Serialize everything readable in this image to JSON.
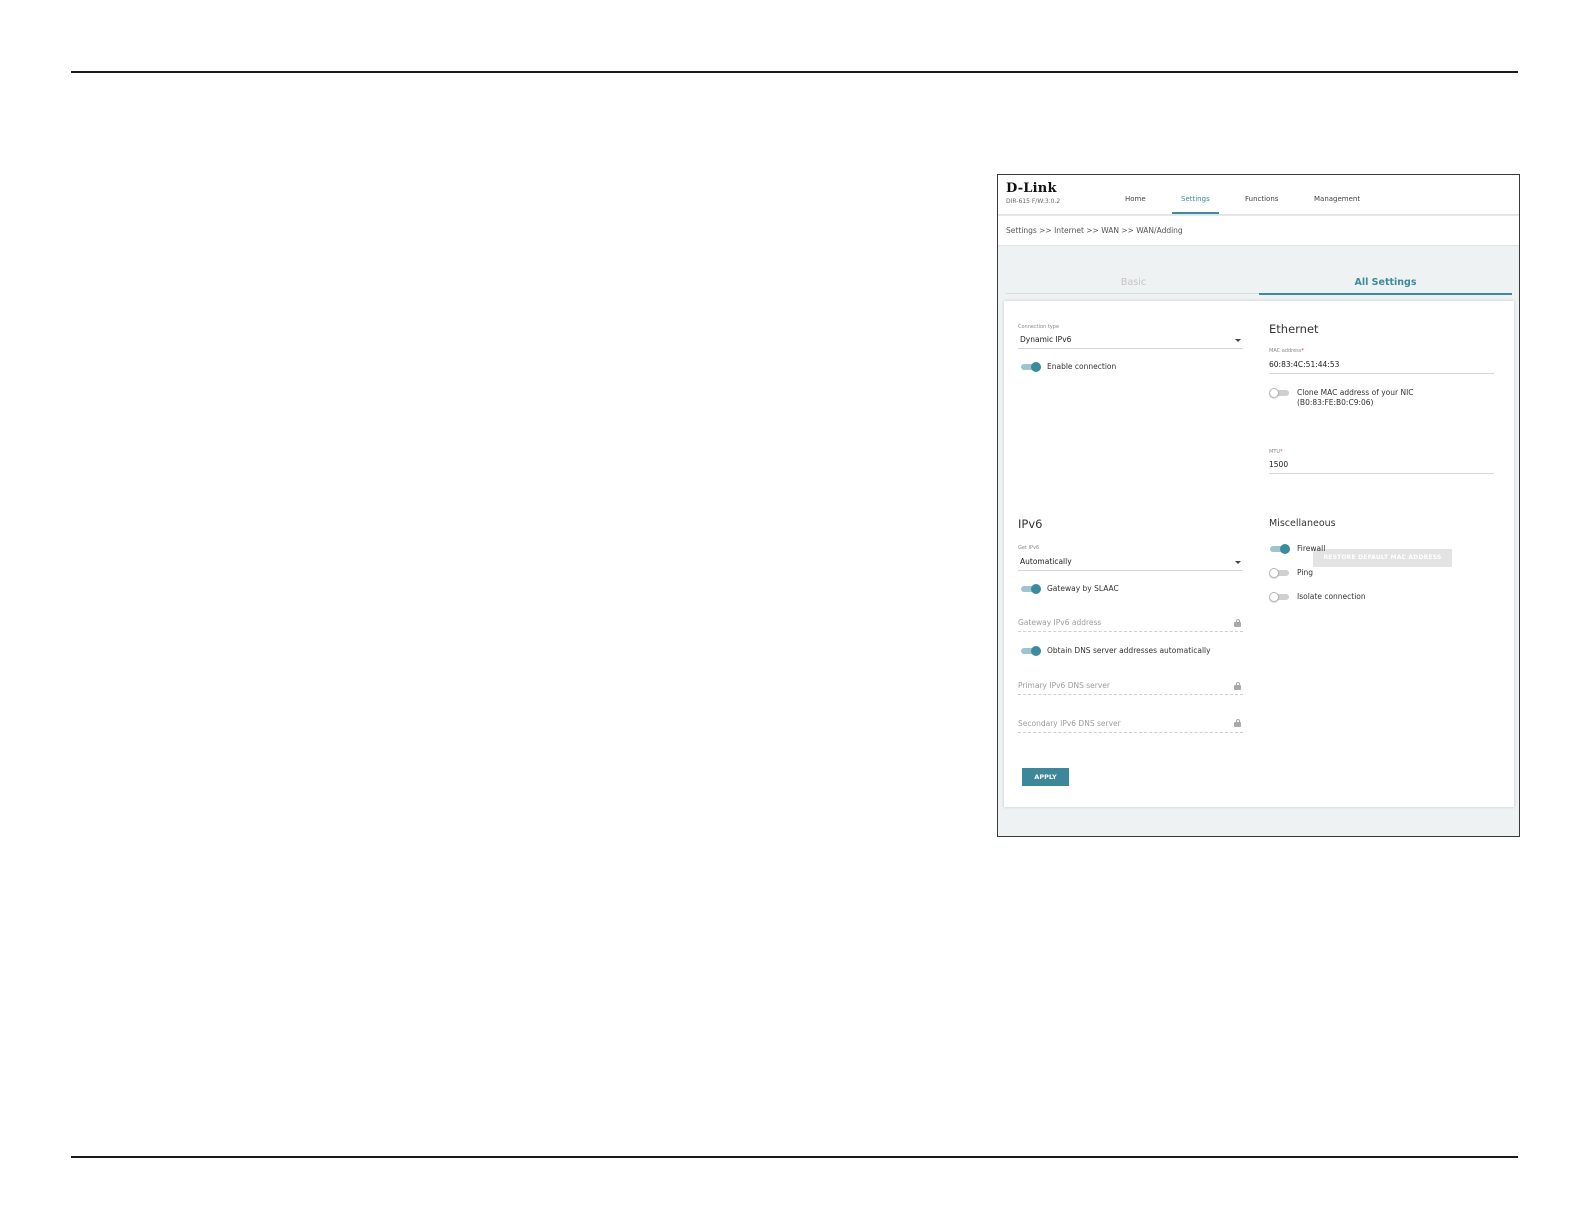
{
  "header": {
    "logo": "D-Link",
    "model": "DIR-615 F/W:3.0.2",
    "nav": [
      "Home",
      "Settings",
      "Functions",
      "Management"
    ]
  },
  "breadcrumb": "Settings >> Internet >> WAN >> WAN/Adding",
  "tabs": {
    "basic": "Basic",
    "all_settings": "All Settings"
  },
  "connection": {
    "type_label": "Connection type",
    "type_value": "Dynamic IPv6",
    "enable_label": "Enable connection",
    "enable_on": true
  },
  "ethernet": {
    "title": "Ethernet",
    "mac_label": "MAC address",
    "mac_value": "60:83:4C:51:44:53",
    "clone_label_line1": "Clone MAC address of your NIC",
    "clone_label_line2": "(B0:83:FE:B0:C9:06)",
    "clone_on": false,
    "restore_button": "RESTORE DEFAULT MAC ADDRESS",
    "mtu_label": "MTU",
    "mtu_value": "1500",
    "required_mark": "*"
  },
  "ipv6": {
    "title": "IPv6",
    "get_label": "Get IPv6",
    "get_value": "Automatically",
    "slaac_label": "Gateway by SLAAC",
    "slaac_on": true,
    "gateway_placeholder": "Gateway IPv6 address",
    "dns_auto_label": "Obtain DNS server addresses automatically",
    "dns_auto_on": true,
    "primary_dns_placeholder": "Primary IPv6 DNS server",
    "secondary_dns_placeholder": "Secondary IPv6 DNS server"
  },
  "misc": {
    "title": "Miscellaneous",
    "firewall_label": "Firewall",
    "firewall_on": true,
    "ping_label": "Ping",
    "ping_on": false,
    "isolate_label": "Isolate connection",
    "isolate_on": false
  },
  "apply_button": "APPLY",
  "colors": {
    "accent": "#3c8a9e",
    "button": "#3e8699"
  }
}
